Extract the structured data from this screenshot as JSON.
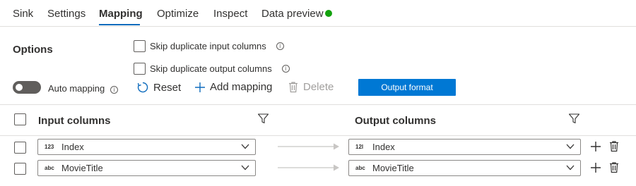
{
  "tabs": [
    {
      "label": "Sink",
      "active": false
    },
    {
      "label": "Settings",
      "active": false
    },
    {
      "label": "Mapping",
      "active": true
    },
    {
      "label": "Optimize",
      "active": false
    },
    {
      "label": "Inspect",
      "active": false
    },
    {
      "label": "Data preview",
      "active": false
    }
  ],
  "data_preview_status": {
    "icon": "status-dot",
    "color": "#13a10e"
  },
  "options": {
    "title": "Options",
    "skip_duplicate_input": {
      "label": "Skip duplicate input columns",
      "checked": false,
      "icon": "info-icon"
    },
    "skip_duplicate_output": {
      "label": "Skip duplicate output columns",
      "checked": false,
      "icon": "info-icon"
    }
  },
  "toolbar": {
    "auto_mapping": {
      "label": "Auto mapping",
      "on": false,
      "icon": "info-icon"
    },
    "reset": {
      "label": "Reset",
      "icon": "refresh-icon"
    },
    "add_mapping": {
      "label": "Add mapping",
      "icon": "plus-icon"
    },
    "delete": {
      "label": "Delete",
      "icon": "trash-icon",
      "disabled": true
    },
    "output_format": {
      "label": "Output format"
    }
  },
  "grid": {
    "input_header": "Input columns",
    "output_header": "Output columns",
    "filter_icon": "filter-icon",
    "rows": [
      {
        "input_type": "123",
        "input": "Index",
        "output_type": "12l",
        "output": "Index"
      },
      {
        "input_type": "abc",
        "input": "MovieTitle",
        "output_type": "abc",
        "output": "MovieTitle"
      }
    ]
  },
  "colors": {
    "accent": "#0f6cbd",
    "primary_button": "#0078d4",
    "success": "#13a10e",
    "toggle_off": "#605e5c",
    "disabled_text": "#a19f9d"
  }
}
